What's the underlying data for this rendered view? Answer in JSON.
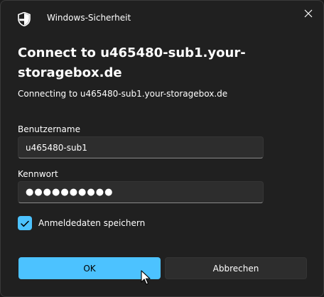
{
  "window": {
    "app_title": "Windows-Sicherheit",
    "close_icon": "close-icon",
    "shield_icon": "shield-icon"
  },
  "dialog": {
    "heading": "Connect to u465480-sub1.your-storagebox.de",
    "subtitle": "Connecting to u465480-sub1.your-storagebox.de"
  },
  "form": {
    "username_label": "Benutzername",
    "username_value": "u465480-sub1",
    "password_label": "Kennwort",
    "password_value": "●●●●●●●●●●",
    "remember_label": "Anmeldedaten speichern",
    "remember_checked": true
  },
  "buttons": {
    "ok_label": "OK",
    "cancel_label": "Abbrechen"
  },
  "colors": {
    "accent": "#4cc2ff",
    "background": "#202020",
    "field_background": "#2d2d2d"
  }
}
